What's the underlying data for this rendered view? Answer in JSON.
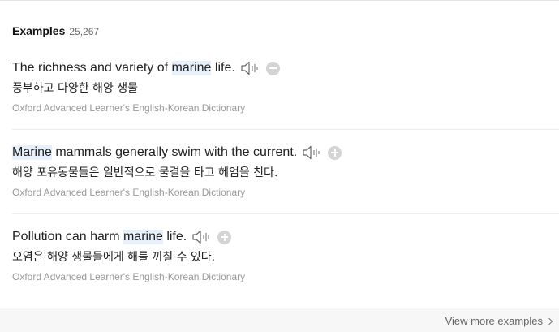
{
  "header": {
    "title": "Examples",
    "count": "25,267"
  },
  "examples": [
    {
      "before": "The richness and variety of ",
      "highlight": "marine",
      "after": " life.",
      "translation": "풍부하고 다양한 해양 생물",
      "source": "Oxford Advanced Learner's English-Korean Dictionary"
    },
    {
      "before": "",
      "highlight": "Marine",
      "after": " mammals generally swim with the current.",
      "translation": "해양 포유동물들은 일반적으로 물결을 타고 헤엄을 친다.",
      "source": "Oxford Advanced Learner's English-Korean Dictionary"
    },
    {
      "before": "Pollution can harm ",
      "highlight": "marine",
      "after": " life.",
      "translation": "오염은 해양 생물들에게 해를 끼칠 수 있다.",
      "source": "Oxford Advanced Learner's English-Korean Dictionary"
    }
  ],
  "footer": {
    "view_more_label": "View more examples"
  },
  "icons": {
    "speaker": "speaker-icon",
    "add": "plus-icon",
    "chevron": "chevron-right-icon"
  },
  "colors": {
    "highlight": "#e8f1fb",
    "muted_text": "#999999",
    "icon_gray": "#d4d4d4"
  }
}
